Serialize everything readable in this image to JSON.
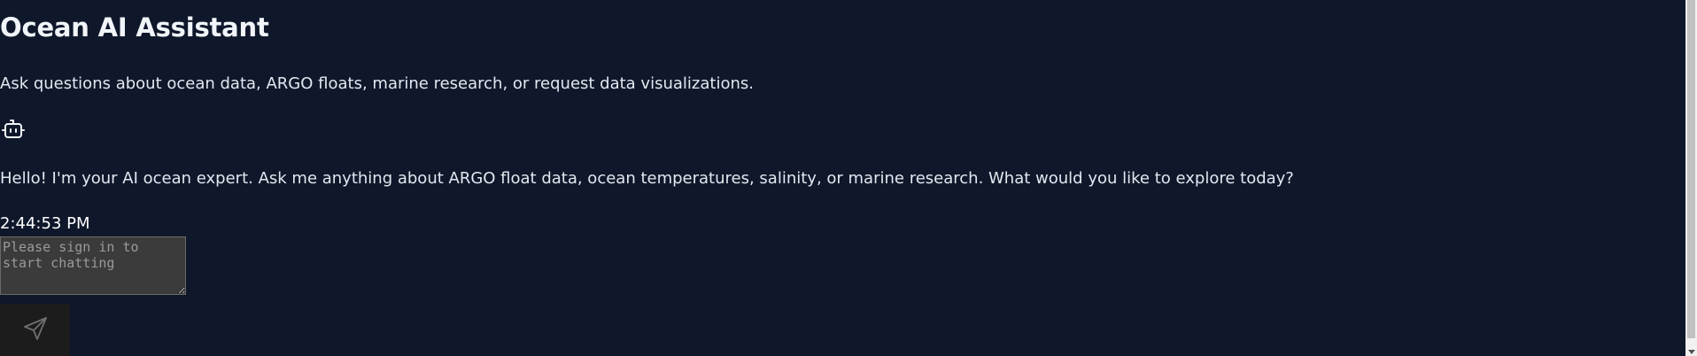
{
  "header": {
    "title": "Ocean AI Assistant",
    "subtitle": "Ask questions about ocean data, ARGO floats, marine research, or request data visualizations."
  },
  "conversation": {
    "avatar_icon": "bot-icon",
    "messages": [
      {
        "role": "assistant",
        "text": "Hello! I'm your AI ocean expert. Ask me anything about ARGO float data, ocean temperatures, salinity, or marine research. What would you like to explore today?",
        "time": "2:44:53 PM"
      }
    ]
  },
  "composer": {
    "placeholder": "Please sign in to start chatting",
    "value": "",
    "send_icon": "send-icon"
  },
  "colors": {
    "background": "#0f172a",
    "text": "#e2e8f0",
    "input_background": "#3b3b3b",
    "send_button_background": "#1c1c1c"
  }
}
